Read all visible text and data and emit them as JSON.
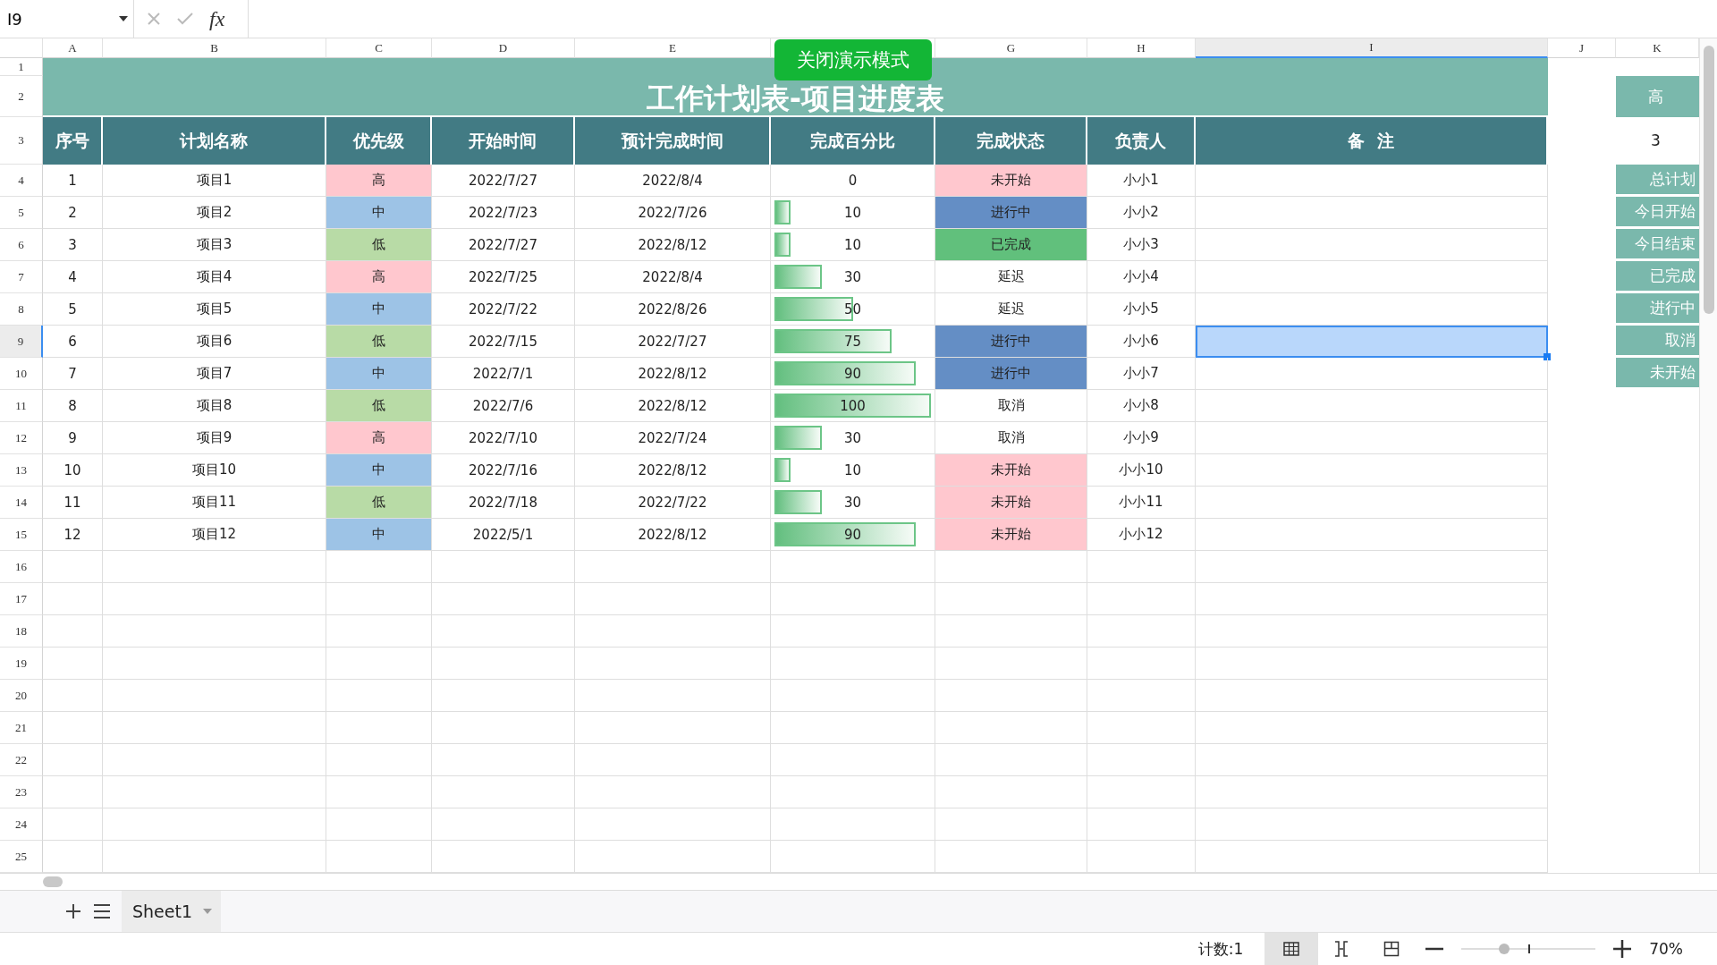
{
  "formula_bar": {
    "cell_ref": "I9",
    "fx": "fx"
  },
  "present_button": "关闭演示模式",
  "column_headers": [
    {
      "label": "A",
      "selected": false
    },
    {
      "label": "B",
      "selected": false
    },
    {
      "label": "C",
      "selected": false
    },
    {
      "label": "D",
      "selected": false
    },
    {
      "label": "E",
      "selected": false
    },
    {
      "covered": true
    },
    {
      "label": "G",
      "selected": false
    },
    {
      "label": "H",
      "selected": false
    },
    {
      "label": "I",
      "selected": true
    },
    {
      "label": "J",
      "selected": false
    },
    {
      "label": "K",
      "selected": false
    }
  ],
  "row_numbers": [
    {
      "label": "1",
      "selected": false
    },
    {
      "label": "2",
      "selected": false
    },
    {
      "label": "3",
      "selected": false
    },
    {
      "label": "4",
      "selected": false
    },
    {
      "label": "5",
      "selected": false
    },
    {
      "label": "6",
      "selected": false
    },
    {
      "label": "7",
      "selected": false
    },
    {
      "label": "8",
      "selected": false
    },
    {
      "label": "9",
      "selected": true
    },
    {
      "label": "10",
      "selected": false
    },
    {
      "label": "11",
      "selected": false
    },
    {
      "label": "12",
      "selected": false
    },
    {
      "label": "13",
      "selected": false
    },
    {
      "label": "14",
      "selected": false
    },
    {
      "label": "15",
      "selected": false
    },
    {
      "label": "16",
      "selected": false
    },
    {
      "label": "17",
      "selected": false
    },
    {
      "label": "18",
      "selected": false
    },
    {
      "label": "19",
      "selected": false
    },
    {
      "label": "20",
      "selected": false
    },
    {
      "label": "21",
      "selected": false
    },
    {
      "label": "22",
      "selected": false
    },
    {
      "label": "23",
      "selected": false
    },
    {
      "label": "24",
      "selected": false
    },
    {
      "label": "25",
      "selected": false
    }
  ],
  "title": "工作计划表-项目进度表",
  "table_headers": [
    "序号",
    "计划名称",
    "优先级",
    "开始时间",
    "预计完成时间",
    "完成百分比",
    "完成状态",
    "负责人",
    "备  注"
  ],
  "rows": [
    {
      "seq": "1",
      "name": "项目1",
      "priority": {
        "label": "高",
        "kind": "high"
      },
      "start": "2022/7/27",
      "end": "2022/8/4",
      "progress": {
        "text": "0"
      },
      "status": {
        "label": "未开始",
        "kind": "not_started"
      },
      "owner": "小小1",
      "note_selected": false
    },
    {
      "seq": "2",
      "name": "项目2",
      "priority": {
        "label": "中",
        "kind": "medium"
      },
      "start": "2022/7/23",
      "end": "2022/7/26",
      "progress": {
        "text": "10",
        "level": 0.1
      },
      "status": {
        "label": "进行中",
        "kind": "in_progress"
      },
      "owner": "小小2",
      "note_selected": false
    },
    {
      "seq": "3",
      "name": "项目3",
      "priority": {
        "label": "低",
        "kind": "low"
      },
      "start": "2022/7/27",
      "end": "2022/8/12",
      "progress": {
        "text": "10",
        "level": 0.1
      },
      "status": {
        "label": "已完成",
        "kind": "done"
      },
      "owner": "小小3",
      "note_selected": false
    },
    {
      "seq": "4",
      "name": "项目4",
      "priority": {
        "label": "高",
        "kind": "high"
      },
      "start": "2022/7/25",
      "end": "2022/8/4",
      "progress": {
        "text": "30",
        "level": 0.3
      },
      "status": {
        "label": "延迟",
        "kind": "delayed"
      },
      "owner": "小小4",
      "note_selected": false
    },
    {
      "seq": "5",
      "name": "项目5",
      "priority": {
        "label": "中",
        "kind": "medium"
      },
      "start": "2022/7/22",
      "end": "2022/8/26",
      "progress": {
        "text": "50",
        "level": 0.5
      },
      "status": {
        "label": "延迟",
        "kind": "delayed"
      },
      "owner": "小小5",
      "note_selected": false
    },
    {
      "seq": "6",
      "name": "项目6",
      "priority": {
        "label": "低",
        "kind": "low"
      },
      "start": "2022/7/15",
      "end": "2022/7/27",
      "progress": {
        "text": "75",
        "level": 0.75
      },
      "status": {
        "label": "进行中",
        "kind": "in_progress"
      },
      "owner": "小小6",
      "note_selected": true
    },
    {
      "seq": "7",
      "name": "项目7",
      "priority": {
        "label": "中",
        "kind": "medium"
      },
      "start": "2022/7/1",
      "end": "2022/8/12",
      "progress": {
        "text": "90",
        "level": 0.9
      },
      "status": {
        "label": "进行中",
        "kind": "in_progress"
      },
      "owner": "小小7",
      "note_selected": false
    },
    {
      "seq": "8",
      "name": "项目8",
      "priority": {
        "label": "低",
        "kind": "low"
      },
      "start": "2022/7/6",
      "end": "2022/8/12",
      "progress": {
        "text": "100",
        "level": 1
      },
      "status": {
        "label": "取消",
        "kind": "cancelled"
      },
      "owner": "小小8",
      "note_selected": false
    },
    {
      "seq": "9",
      "name": "项目9",
      "priority": {
        "label": "高",
        "kind": "high"
      },
      "start": "2022/7/10",
      "end": "2022/7/24",
      "progress": {
        "text": "30",
        "level": 0.3
      },
      "status": {
        "label": "取消",
        "kind": "cancelled"
      },
      "owner": "小小9",
      "note_selected": false
    },
    {
      "seq": "10",
      "name": "项目10",
      "priority": {
        "label": "中",
        "kind": "medium"
      },
      "start": "2022/7/16",
      "end": "2022/8/12",
      "progress": {
        "text": "10",
        "level": 0.1
      },
      "status": {
        "label": "未开始",
        "kind": "not_started"
      },
      "owner": "小小10",
      "note_selected": false
    },
    {
      "seq": "11",
      "name": "项目11",
      "priority": {
        "label": "低",
        "kind": "low"
      },
      "start": "2022/7/18",
      "end": "2022/7/22",
      "progress": {
        "text": "30",
        "level": 0.3
      },
      "status": {
        "label": "未开始",
        "kind": "not_started"
      },
      "owner": "小小11",
      "note_selected": false
    },
    {
      "seq": "12",
      "name": "项目12",
      "priority": {
        "label": "中",
        "kind": "medium"
      },
      "start": "2022/5/1",
      "end": "2022/8/12",
      "progress": {
        "text": "90",
        "level": 0.9
      },
      "status": {
        "label": "未开始",
        "kind": "not_started"
      },
      "owner": "小小12",
      "note_selected": false
    }
  ],
  "side_panel": {
    "filter": "高",
    "count": "3",
    "buttons": [
      "总计划",
      "今日开始",
      "今日结束",
      "已完成",
      "进行中",
      "取消",
      "未开始"
    ]
  },
  "sheet_tabs": [
    {
      "label": "Sheet1",
      "selected": true
    }
  ],
  "status_bar": {
    "count": "计数:1",
    "views": [
      {
        "kind": "normal",
        "selected": true
      },
      {
        "kind": "page_break",
        "selected": false
      },
      {
        "kind": "page_layout",
        "selected": false
      }
    ],
    "zoom": {
      "level": 0.32,
      "text": "70%"
    }
  }
}
